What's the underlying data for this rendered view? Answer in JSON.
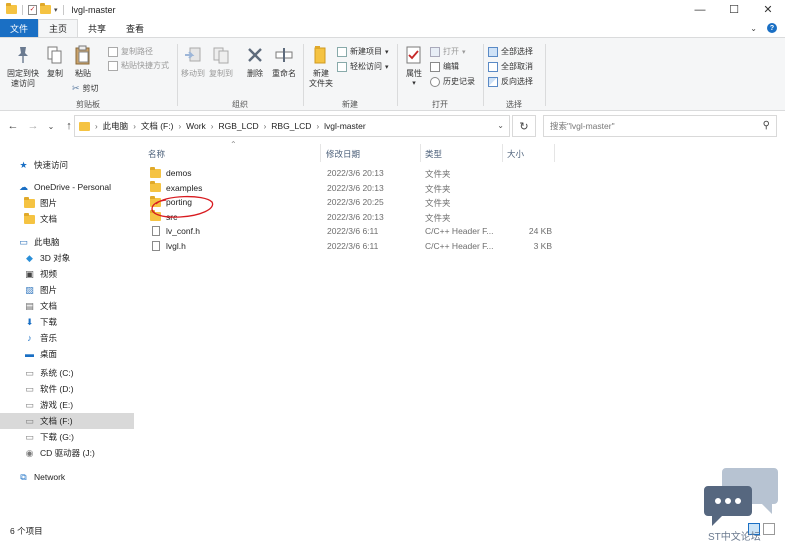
{
  "window": {
    "title": "lvgl-master",
    "controls": {
      "minimize": "—",
      "maximize": "☐",
      "close": "✕"
    }
  },
  "ribbon_tabs": [
    {
      "label": "文件"
    },
    {
      "label": "主页"
    },
    {
      "label": "共享"
    },
    {
      "label": "查看"
    }
  ],
  "ribbon": {
    "clipboard": {
      "label": "剪贴板",
      "pin": "固定到快\n速访问",
      "copy": "复制",
      "paste": "粘贴",
      "copy_path": "复制路径",
      "paste_shortcut": "粘贴快捷方式",
      "cut": "剪切"
    },
    "organize": {
      "label": "组织",
      "move_to": "移动到",
      "copy_to": "复制到",
      "delete": "删除",
      "rename": "重命名"
    },
    "new": {
      "label": "新建",
      "new_folder": "新建\n文件夹",
      "new_item": "新建项目",
      "easy_access": "轻松访问"
    },
    "open": {
      "label": "打开",
      "properties": "属性",
      "open": "打开",
      "edit": "编辑",
      "history": "历史记录"
    },
    "select": {
      "label": "选择",
      "select_all": "全部选择",
      "select_none": "全部取消",
      "invert": "反向选择"
    }
  },
  "address": {
    "crumbs": [
      "此电脑",
      "文档 (F:)",
      "Work",
      "RGB_LCD",
      "RBG_LCD",
      "lvgl-master"
    ],
    "search_placeholder": "搜索\"lvgl-master\""
  },
  "nav_pane": [
    {
      "label": "快速访问",
      "icon": "star-icon",
      "indent": 0,
      "selected": false
    },
    {
      "label": "OneDrive - Personal",
      "icon": "cloud-icon",
      "indent": 0,
      "selected": false
    },
    {
      "label": "图片",
      "icon": "folder-icon",
      "indent": 1,
      "selected": false
    },
    {
      "label": "文档",
      "icon": "folder-icon",
      "indent": 1,
      "selected": false
    },
    {
      "label": "此电脑",
      "icon": "computer-icon",
      "indent": 0,
      "selected": false
    },
    {
      "label": "3D 对象",
      "icon": "cube-icon",
      "indent": 1,
      "selected": false
    },
    {
      "label": "视频",
      "icon": "video-icon",
      "indent": 1,
      "selected": false
    },
    {
      "label": "图片",
      "icon": "picture-icon",
      "indent": 1,
      "selected": false
    },
    {
      "label": "文档",
      "icon": "document-icon",
      "indent": 1,
      "selected": false
    },
    {
      "label": "下载",
      "icon": "download-icon",
      "indent": 1,
      "selected": false
    },
    {
      "label": "音乐",
      "icon": "music-icon",
      "indent": 1,
      "selected": false
    },
    {
      "label": "桌面",
      "icon": "desktop-icon",
      "indent": 1,
      "selected": false
    },
    {
      "label": "系统 (C:)",
      "icon": "drive-icon",
      "indent": 1,
      "selected": false
    },
    {
      "label": "软件 (D:)",
      "icon": "drive-icon",
      "indent": 1,
      "selected": false
    },
    {
      "label": "游戏 (E:)",
      "icon": "drive-icon",
      "indent": 1,
      "selected": false
    },
    {
      "label": "文档 (F:)",
      "icon": "drive-icon",
      "indent": 1,
      "selected": true
    },
    {
      "label": "下载 (G:)",
      "icon": "drive-icon",
      "indent": 1,
      "selected": false
    },
    {
      "label": "CD 驱动器 (J:)",
      "icon": "cd-drive-icon",
      "indent": 1,
      "selected": false
    },
    {
      "label": "Network",
      "icon": "network-icon",
      "indent": 0,
      "selected": false
    }
  ],
  "columns": {
    "name": "名称",
    "date": "修改日期",
    "type": "类型",
    "size": "大小"
  },
  "files": [
    {
      "name": "demos",
      "date": "2022/3/6 20:13",
      "type": "文件夹",
      "size": "",
      "kind": "folder"
    },
    {
      "name": "examples",
      "date": "2022/3/6 20:13",
      "type": "文件夹",
      "size": "",
      "kind": "folder"
    },
    {
      "name": "porting",
      "date": "2022/3/6 20:25",
      "type": "文件夹",
      "size": "",
      "kind": "folder"
    },
    {
      "name": "src",
      "date": "2022/3/6 20:13",
      "type": "文件夹",
      "size": "",
      "kind": "folder"
    },
    {
      "name": "lv_conf.h",
      "date": "2022/3/6 6:11",
      "type": "C/C++ Header F...",
      "size": "24 KB",
      "kind": "file"
    },
    {
      "name": "lvgl.h",
      "date": "2022/3/6 6:11",
      "type": "C/C++ Header F...",
      "size": "3 KB",
      "kind": "file"
    }
  ],
  "status": {
    "item_count": "6 个项目"
  },
  "watermark": {
    "text": "ST中文论坛"
  },
  "colors": {
    "accent": "#1a6fc4",
    "folder": "#f5c342",
    "selected_nav": "#d9d9d9",
    "annotation": "#d81b20"
  }
}
